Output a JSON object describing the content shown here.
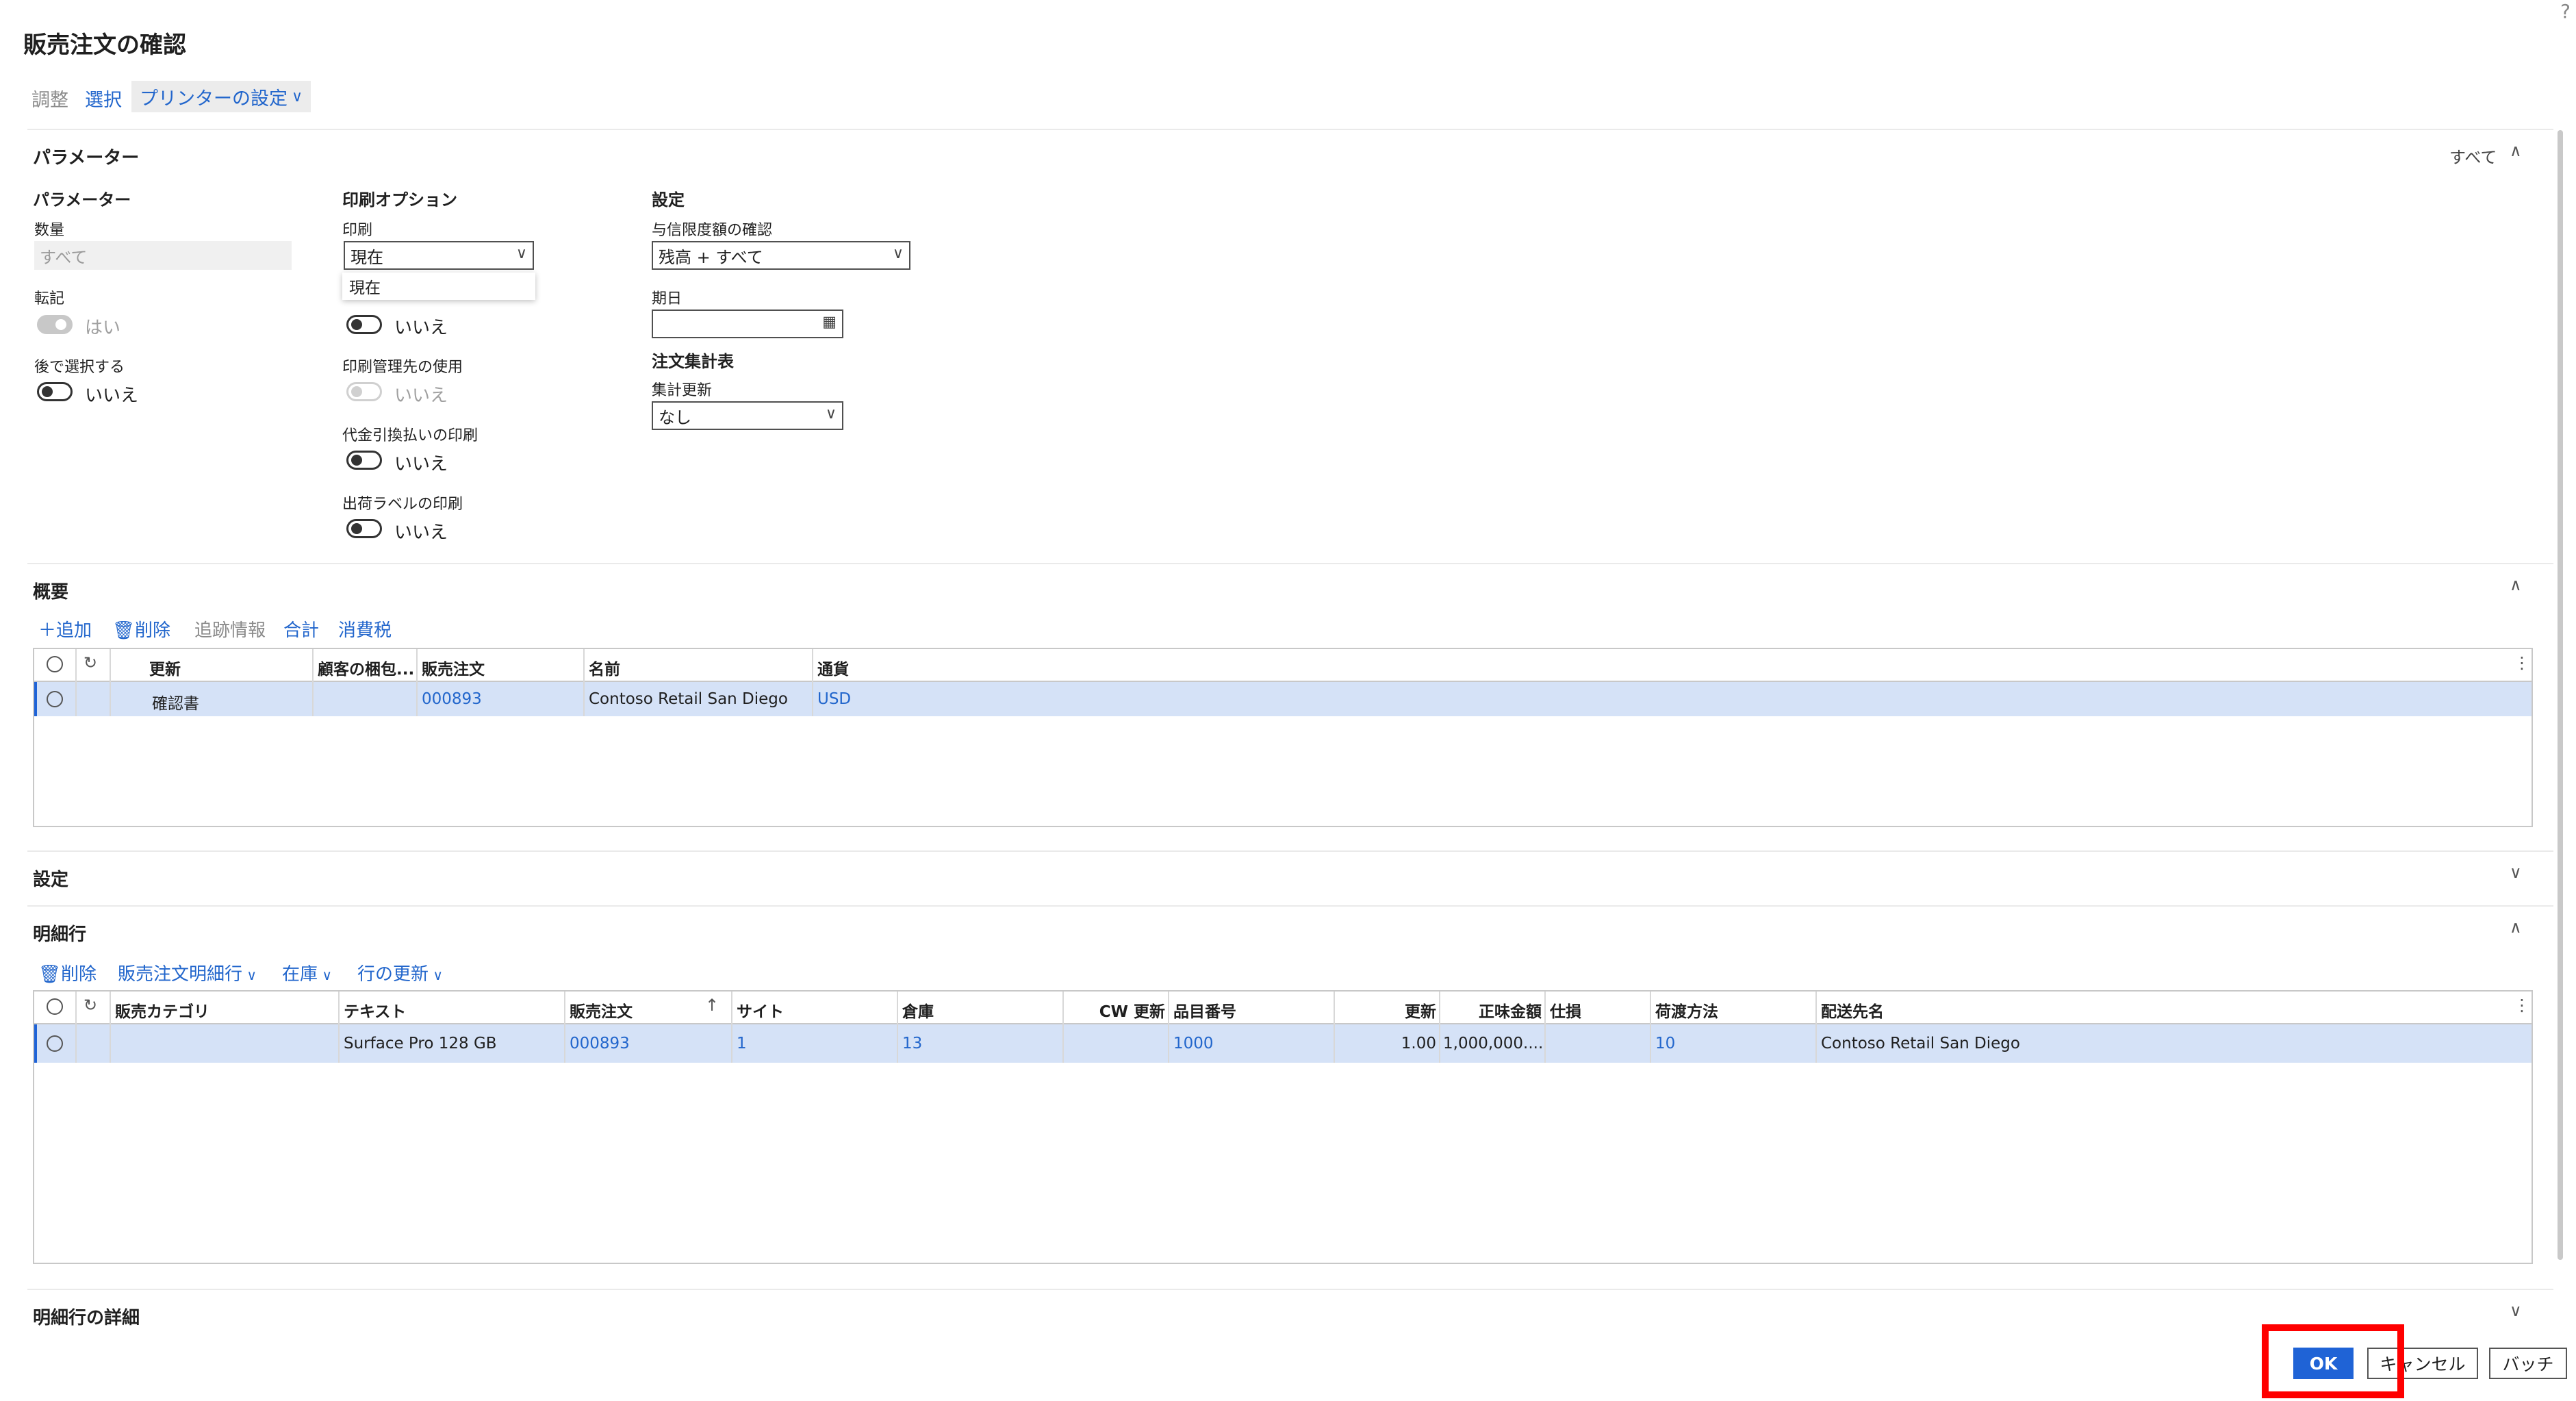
{
  "window": {
    "title": "販売注文の確認",
    "help": "?"
  },
  "toolbar": {
    "adjust": "調整",
    "select": "選択",
    "printer": "プリンターの設定"
  },
  "params": {
    "section": "パラメーター",
    "all": "すべて",
    "col1": {
      "title": "パラメーター",
      "qty_label": "数量",
      "qty_value": "すべて",
      "posting_label": "転記",
      "posting_value": "はい",
      "later_label": "後で選択する",
      "later_value": "いいえ"
    },
    "col2": {
      "title": "印刷オプション",
      "print_label": "印刷",
      "print_value": "現在",
      "dropdown_option": "現在",
      "print_toggle_value": "いいえ",
      "mgmt_label": "印刷管理先の使用",
      "mgmt_value": "いいえ",
      "cod_label": "代金引換払いの印刷",
      "cod_value": "いいえ",
      "ship_label": "出荷ラベルの印刷",
      "ship_value": "いいえ"
    },
    "col3": {
      "title": "設定",
      "credit_label": "与信限度額の確認",
      "credit_value": "残高 + すべて",
      "due_label": "期日",
      "due_value": "",
      "summary_title": "注文集計表",
      "summary_update_label": "集計更新",
      "summary_update_value": "なし"
    }
  },
  "overview": {
    "section": "概要",
    "actions": {
      "add": "追加",
      "delete": "削除",
      "tracking": "追跡情報",
      "total": "合計",
      "tax": "消費税"
    },
    "headers": [
      "更新",
      "顧客の梱包...",
      "販売注文",
      "名前",
      "通貨"
    ],
    "rows": [
      {
        "update": "確認書",
        "packing": "",
        "order": "000893",
        "name": "Contoso Retail San Diego",
        "currency": "USD"
      }
    ]
  },
  "settings": {
    "section": "設定"
  },
  "lines": {
    "section": "明細行",
    "actions": {
      "delete": "削除",
      "sales_line": "販売注文明細行",
      "inventory": "在庫",
      "update_line": "行の更新"
    },
    "headers": [
      "販売カテゴリ",
      "テキスト",
      "販売注文",
      "サイト",
      "倉庫",
      "CW 更新",
      "品目番号",
      "更新",
      "正味金額",
      "仕損",
      "荷渡方法",
      "配送先名"
    ],
    "rows": [
      {
        "category": "",
        "text": "Surface Pro 128 GB",
        "order": "000893",
        "site": "1",
        "warehouse": "13",
        "cw": "",
        "item": "1000",
        "update": "1.00",
        "net": "1,000,000....",
        "waste": "",
        "delivery": "10",
        "ship_to": "Contoso Retail San Diego"
      }
    ]
  },
  "line_details": {
    "section": "明細行の詳細"
  },
  "footer": {
    "ok": "OK",
    "cancel": "キャンセル",
    "batch": "バッチ"
  },
  "colors": {
    "accent": "#1f63d6",
    "link": "#2266cc",
    "selected_row": "#d5e2f7",
    "highlight": "#ff0000"
  }
}
